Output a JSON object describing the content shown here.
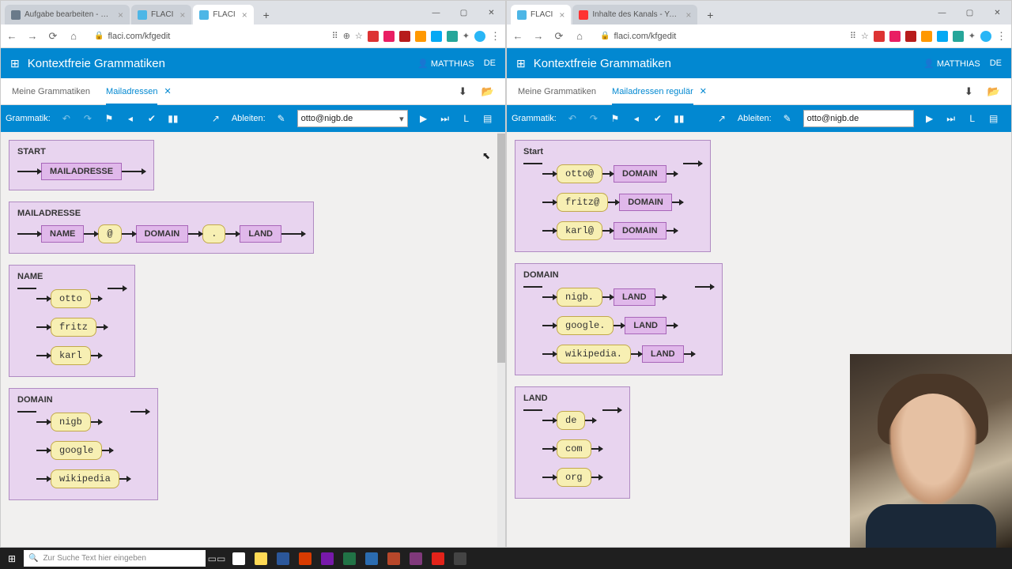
{
  "left": {
    "tabs": [
      {
        "title": "Aufgabe bearbeiten - Verwalte",
        "fav": "#6a7a8a",
        "active": false
      },
      {
        "title": "FLACI",
        "fav": "#4db6e6",
        "active": false
      },
      {
        "title": "FLACI",
        "fav": "#4db6e6",
        "active": true
      }
    ],
    "url": "flaci.com/kfgedit",
    "app_title": "Kontextfreie Grammatiken",
    "user": "MATTHIAS",
    "lang": "DE",
    "gram_tabs": [
      "Meine Grammatiken",
      "Mailadressen"
    ],
    "active_gtab": 1,
    "toolbar": {
      "gram": "Grammatik:",
      "derive": "Ableiten:",
      "input": "otto@nigb.de",
      "L": "L"
    },
    "rules": [
      {
        "name": "START",
        "alts": [
          [
            {
              "t": "n",
              "v": "MAILADRESSE"
            }
          ]
        ]
      },
      {
        "name": "MAILADRESSE",
        "alts": [
          [
            {
              "t": "n",
              "v": "NAME"
            },
            {
              "t": "t",
              "v": "@"
            },
            {
              "t": "n",
              "v": "DOMAIN"
            },
            {
              "t": "t",
              "v": "."
            },
            {
              "t": "n",
              "v": "LAND"
            }
          ]
        ]
      },
      {
        "name": "NAME",
        "alts": [
          [
            {
              "t": "t",
              "v": "otto"
            }
          ],
          [
            {
              "t": "t",
              "v": "fritz"
            }
          ],
          [
            {
              "t": "t",
              "v": "karl"
            }
          ]
        ]
      },
      {
        "name": "DOMAIN",
        "alts": [
          [
            {
              "t": "t",
              "v": "nigb"
            }
          ],
          [
            {
              "t": "t",
              "v": "google"
            }
          ],
          [
            {
              "t": "t",
              "v": "wikipedia"
            }
          ]
        ]
      }
    ]
  },
  "right": {
    "tabs": [
      {
        "title": "FLACI",
        "fav": "#4db6e6",
        "active": true
      },
      {
        "title": "Inhalte des Kanals - YouTube St",
        "fav": "#ff3333",
        "active": false
      }
    ],
    "url": "flaci.com/kfgedit",
    "app_title": "Kontextfreie Grammatiken",
    "user": "MATTHIAS",
    "lang": "DE",
    "gram_tabs": [
      "Meine Grammatiken",
      "Mailadressen regulär"
    ],
    "active_gtab": 1,
    "toolbar": {
      "gram": "Grammatik:",
      "derive": "Ableiten:",
      "input": "otto@nigb.de",
      "L": "L"
    },
    "rules": [
      {
        "name": "Start",
        "alts": [
          [
            {
              "t": "t",
              "v": "otto@"
            },
            {
              "t": "n",
              "v": "DOMAIN"
            }
          ],
          [
            {
              "t": "t",
              "v": "fritz@"
            },
            {
              "t": "n",
              "v": "DOMAIN"
            }
          ],
          [
            {
              "t": "t",
              "v": "karl@"
            },
            {
              "t": "n",
              "v": "DOMAIN"
            }
          ]
        ]
      },
      {
        "name": "DOMAIN",
        "alts": [
          [
            {
              "t": "t",
              "v": "nigb."
            },
            {
              "t": "n",
              "v": "LAND"
            }
          ],
          [
            {
              "t": "t",
              "v": "google."
            },
            {
              "t": "n",
              "v": "LAND"
            }
          ],
          [
            {
              "t": "t",
              "v": "wikipedia."
            },
            {
              "t": "n",
              "v": "LAND"
            }
          ]
        ]
      },
      {
        "name": "LAND",
        "alts": [
          [
            {
              "t": "t",
              "v": "de"
            }
          ],
          [
            {
              "t": "t",
              "v": "com"
            }
          ],
          [
            {
              "t": "t",
              "v": "org"
            }
          ]
        ]
      }
    ]
  },
  "taskbar": {
    "search_placeholder": "Zur Suche Text hier eingeben",
    "apps": [
      "#ffffff",
      "#ffda55",
      "#2b579a",
      "#d83b01",
      "#7719aa",
      "#217346",
      "#2b6cb0",
      "#b7472a",
      "#80397b",
      "#e2231a",
      "#444444"
    ]
  }
}
